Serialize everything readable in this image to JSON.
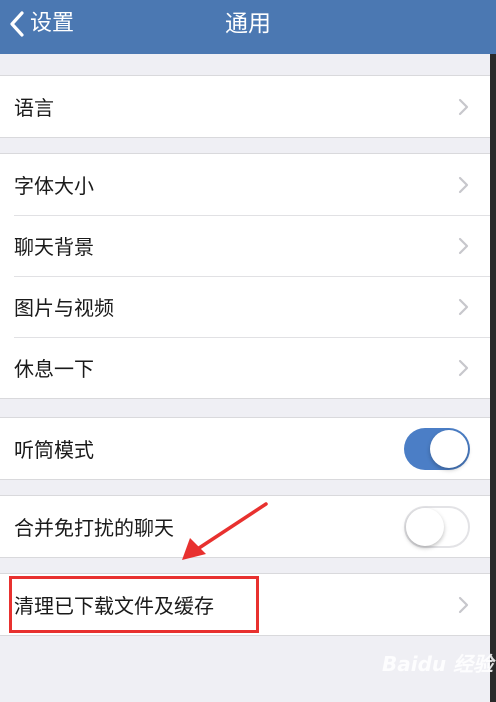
{
  "nav": {
    "back_label": "设置",
    "title": "通用"
  },
  "groups": [
    {
      "rows": [
        {
          "label": "语言",
          "control": "chevron"
        }
      ]
    },
    {
      "rows": [
        {
          "label": "字体大小",
          "control": "chevron"
        },
        {
          "label": "聊天背景",
          "control": "chevron"
        },
        {
          "label": "图片与视频",
          "control": "chevron"
        },
        {
          "label": "休息一下",
          "control": "chevron"
        }
      ]
    },
    {
      "rows": [
        {
          "label": "听筒模式",
          "control": "toggle",
          "on": true
        }
      ]
    },
    {
      "rows": [
        {
          "label": "合并免打扰的聊天",
          "control": "toggle",
          "on": false
        }
      ]
    },
    {
      "rows": [
        {
          "label": "清理已下载文件及缓存",
          "control": "chevron"
        }
      ]
    }
  ],
  "annotation": {
    "highlight_color": "#e8312f"
  },
  "watermark": {
    "text": "Baidu 经验"
  },
  "colors": {
    "nav_background": "#4b78b2",
    "toggle_on": "#4b7ec6",
    "page_background": "#efeff4"
  }
}
